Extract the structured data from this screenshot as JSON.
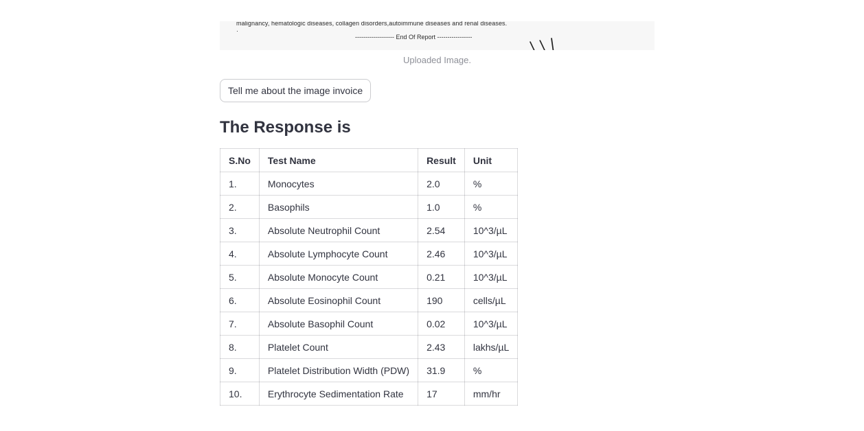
{
  "uploaded_image": {
    "line1": "malignancy, hematologic diseases, collagen disorders,autoimmune diseases and renal diseases.",
    "dot": "·",
    "line2": "------------------- End Of Report -----------------",
    "mark": "\\ \\ |",
    "caption": "Uploaded Image."
  },
  "ask_button": {
    "label": "Tell me about the image invoice"
  },
  "response": {
    "heading": "The Response is",
    "columns": [
      "S.No",
      "Test Name",
      "Result",
      "Unit"
    ],
    "rows": [
      [
        "1.",
        "Monocytes",
        "2.0",
        "%"
      ],
      [
        "2.",
        "Basophils",
        "1.0",
        "%"
      ],
      [
        "3.",
        "Absolute Neutrophil Count",
        "2.54",
        "10^3/µL"
      ],
      [
        "4.",
        "Absolute Lymphocyte Count",
        "2.46",
        "10^3/µL"
      ],
      [
        "5.",
        "Absolute Monocyte Count",
        "0.21",
        "10^3/µL"
      ],
      [
        "6.",
        "Absolute Eosinophil Count",
        "190",
        "cells/µL"
      ],
      [
        "7.",
        "Absolute Basophil Count",
        "0.02",
        "10^3/µL"
      ],
      [
        "8.",
        "Platelet Count",
        "2.43",
        "lakhs/µL"
      ],
      [
        "9.",
        "Platelet Distribution Width (PDW)",
        "31.9",
        "%"
      ],
      [
        "10.",
        "Erythrocyte Sedimentation Rate",
        "17",
        "mm/hr"
      ]
    ]
  }
}
